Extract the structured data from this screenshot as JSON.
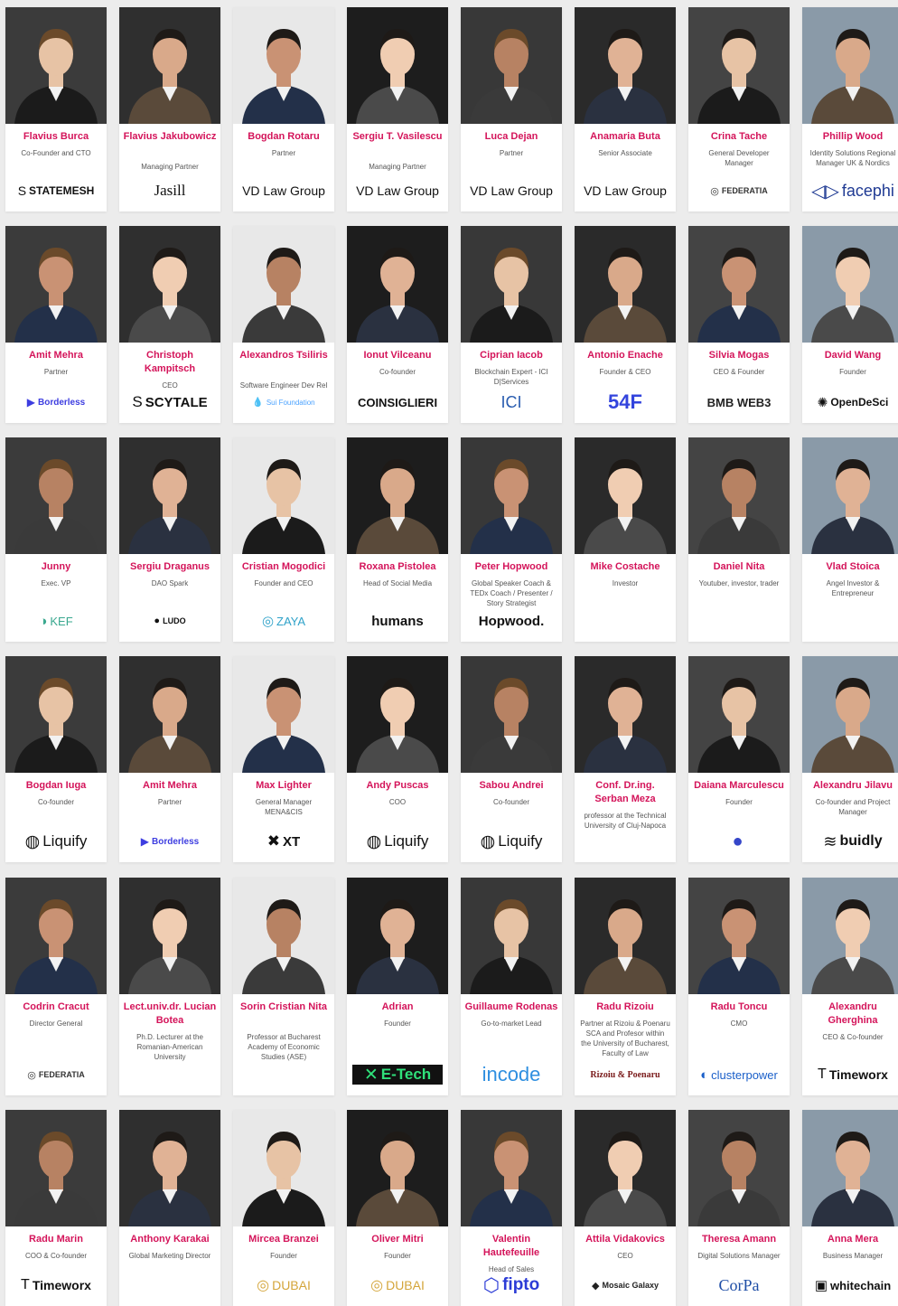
{
  "speakers": [
    {
      "name": "Flavius Burca",
      "role": "Co-Founder and CTO",
      "logo": {
        "text": "STATEMESH",
        "icon": "statemesh-logo-icon",
        "glyph": "S",
        "color": "#111111",
        "size": 12,
        "weight": "bold"
      }
    },
    {
      "name": "Flavius Jakubowicz",
      "role": "Managing Partner",
      "logo": {
        "text": "Jasill",
        "icon": "jasill-logo-icon",
        "glyph": "",
        "color": "#111111",
        "size": 17,
        "weight": "normal",
        "serif": true
      }
    },
    {
      "name": "Bogdan Rotaru",
      "role": "Partner",
      "logo": {
        "text": "VD Law Group",
        "icon": "vd-law-logo-icon",
        "glyph": "",
        "color": "#111111",
        "size": 14,
        "weight": "normal"
      }
    },
    {
      "name": "Sergiu T. Vasilescu",
      "role": "Managing Partner",
      "logo": {
        "text": "VD Law Group",
        "icon": "vd-law-logo-icon",
        "glyph": "",
        "color": "#111111",
        "size": 14,
        "weight": "normal"
      }
    },
    {
      "name": "Luca Dejan",
      "role": "Partner",
      "logo": {
        "text": "VD Law Group",
        "icon": "vd-law-logo-icon",
        "glyph": "",
        "color": "#111111",
        "size": 14,
        "weight": "normal"
      }
    },
    {
      "name": "Anamaria Buta",
      "role": "Senior Associate",
      "logo": {
        "text": "VD Law Group",
        "icon": "vd-law-logo-icon",
        "glyph": "",
        "color": "#111111",
        "size": 14,
        "weight": "normal"
      }
    },
    {
      "name": "Crina Tache",
      "role": "General Developer Manager",
      "logo": {
        "text": "FEDERATIA",
        "icon": "federatia-logo-icon",
        "glyph": "◎",
        "color": "#333333",
        "size": 9,
        "weight": "bold"
      }
    },
    {
      "name": "Phillip Wood",
      "role": "Identity Solutions Regional Manager UK & Nordics",
      "logo": {
        "text": "facephi",
        "icon": "facephi-logo-icon",
        "glyph": "◁▷",
        "color": "#1f3a93",
        "size": 18,
        "weight": "normal"
      }
    },
    {
      "name": "Amit Mehra",
      "role": "Partner",
      "logo": {
        "text": "Borderless",
        "icon": "borderless-logo-icon",
        "glyph": "▶",
        "color": "#3d3de0",
        "size": 10,
        "weight": "bold"
      }
    },
    {
      "name": "Christoph Kampitsch",
      "role": "CEO",
      "logo": {
        "text": "SCYTALE",
        "icon": "scytale-logo-icon",
        "glyph": "S",
        "color": "#111111",
        "size": 15,
        "weight": "bold"
      }
    },
    {
      "name": "Alexandros Tsiliris",
      "role": "Software Engineer Dev Rel",
      "logo": {
        "text": "Sui Foundation",
        "icon": "sui-logo-icon",
        "glyph": "💧",
        "color": "#4ca3ff",
        "size": 8,
        "weight": "normal"
      }
    },
    {
      "name": "Ionut Vilceanu",
      "role": "Co-founder",
      "logo": {
        "text": "COINSIGLIERI",
        "icon": "coinsiglieri-logo-icon",
        "glyph": "",
        "color": "#111111",
        "size": 13,
        "weight": "bold"
      }
    },
    {
      "name": "Ciprian Iacob",
      "role": "Blockchain Expert - ICI D|Services",
      "logo": {
        "text": "ICI",
        "icon": "ici-logo-icon",
        "glyph": "",
        "color": "#2a5db0",
        "size": 18,
        "weight": "normal"
      }
    },
    {
      "name": "Antonio Enache",
      "role": "Founder & CEO",
      "logo": {
        "text": "54F",
        "icon": "54f-logo-icon",
        "glyph": "",
        "color": "#3344dd",
        "size": 22,
        "weight": "bold"
      }
    },
    {
      "name": "Silvia Mogas",
      "role": "CEO & Founder",
      "logo": {
        "text": "BMB WEB3",
        "icon": "bmb-logo-icon",
        "glyph": "",
        "color": "#222222",
        "size": 13,
        "weight": "bold"
      }
    },
    {
      "name": "David Wang",
      "role": "Founder",
      "logo": {
        "text": "OpenDeSci",
        "icon": "opendesci-logo-icon",
        "glyph": "✺",
        "color": "#111111",
        "size": 12,
        "weight": "bold"
      }
    },
    {
      "name": "Junny",
      "role": "Exec. VP",
      "logo": {
        "text": "KEF",
        "icon": "kef-logo-icon",
        "glyph": "◑",
        "color": "#3aa88f",
        "size": 13,
        "weight": "normal"
      }
    },
    {
      "name": "Sergiu Draganus",
      "role": "DAO Spark",
      "logo": {
        "text": "LUDO",
        "icon": "ludo-logo-icon",
        "glyph": "●",
        "color": "#111111",
        "size": 9,
        "weight": "bold"
      }
    },
    {
      "name": "Cristian Mogodici",
      "role": "Founder and CEO",
      "logo": {
        "text": "ZAYA",
        "icon": "zaya-logo-icon",
        "glyph": "◎",
        "color": "#2fa2c9",
        "size": 13,
        "weight": "normal"
      }
    },
    {
      "name": "Roxana Pistolea",
      "role": "Head of Social Media",
      "logo": {
        "text": "humans",
        "icon": "humans-logo-icon",
        "glyph": "",
        "color": "#111111",
        "size": 15,
        "weight": "bold"
      }
    },
    {
      "name": "Peter Hopwood",
      "role": "Global Speaker Coach & TEDx Coach / Presenter / Story Strategist",
      "logo": {
        "text": "Hopwood.",
        "icon": "hopwood-logo-icon",
        "glyph": "",
        "color": "#111111",
        "size": 15,
        "weight": "bold"
      }
    },
    {
      "name": "Mike Costache",
      "role": "Investor",
      "logo": {
        "text": "",
        "icon": "",
        "glyph": "",
        "color": "#111111",
        "size": 12,
        "weight": "normal"
      }
    },
    {
      "name": "Daniel Nita",
      "role": "Youtuber, investor, trader",
      "logo": {
        "text": "",
        "icon": "",
        "glyph": "",
        "color": "#111111",
        "size": 12,
        "weight": "normal"
      }
    },
    {
      "name": "Vlad Stoica",
      "role": "Angel Investor & Entrepreneur",
      "logo": {
        "text": "",
        "icon": "",
        "glyph": "",
        "color": "#111111",
        "size": 12,
        "weight": "normal"
      }
    },
    {
      "name": "Bogdan Iuga",
      "role": "Co-founder",
      "logo": {
        "text": "Liquify",
        "icon": "liquify-logo-icon",
        "glyph": "◍",
        "color": "#111111",
        "size": 17,
        "weight": "normal"
      }
    },
    {
      "name": "Amit Mehra",
      "role": "Partner",
      "logo": {
        "text": "Borderless",
        "icon": "borderless-logo-icon",
        "glyph": "▶",
        "color": "#3d3de0",
        "size": 10,
        "weight": "bold"
      }
    },
    {
      "name": "Max Lighter",
      "role": "General Manager MENA&CIS",
      "logo": {
        "text": "XT",
        "icon": "xt-logo-icon",
        "glyph": "✖",
        "color": "#111111",
        "size": 15,
        "weight": "bold"
      }
    },
    {
      "name": "Andy Puscas",
      "role": "COO",
      "logo": {
        "text": "Liquify",
        "icon": "liquify-logo-icon",
        "glyph": "◍",
        "color": "#111111",
        "size": 17,
        "weight": "normal"
      }
    },
    {
      "name": "Sabou Andrei",
      "role": "Co-founder",
      "logo": {
        "text": "Liquify",
        "icon": "liquify-logo-icon",
        "glyph": "◍",
        "color": "#111111",
        "size": 17,
        "weight": "normal"
      }
    },
    {
      "name": "Conf. Dr.ing. Serban Meza",
      "role": "professor at the Technical University of Cluj-Napoca",
      "logo": {
        "text": "",
        "icon": "",
        "glyph": "",
        "color": "#111111",
        "size": 12,
        "weight": "normal"
      }
    },
    {
      "name": "Daiana Marculescu",
      "role": "Founder",
      "logo": {
        "text": "",
        "icon": "round-logo-icon",
        "glyph": "●",
        "color": "#3546c9",
        "size": 18,
        "weight": "normal"
      }
    },
    {
      "name": "Alexandru Jilavu",
      "role": "Co-founder and Project Manager",
      "logo": {
        "text": "buidly",
        "icon": "buidly-logo-icon",
        "glyph": "≋",
        "color": "#111111",
        "size": 16,
        "weight": "bold"
      }
    },
    {
      "name": "Codrin Cracut",
      "role": "Director General",
      "logo": {
        "text": "FEDERATIA",
        "icon": "federatia-logo-icon",
        "glyph": "◎",
        "color": "#333333",
        "size": 9,
        "weight": "bold"
      }
    },
    {
      "name": "Lect.univ.dr. Lucian Botea",
      "role": "Ph.D. Lecturer at the Romanian-American University",
      "logo": {
        "text": "",
        "icon": "",
        "glyph": "",
        "color": "#111111",
        "size": 12,
        "weight": "normal"
      }
    },
    {
      "name": "Sorin Cristian Nita",
      "role": "Professor at Bucharest Academy of Economic Studies (ASE)",
      "logo": {
        "text": "",
        "icon": "",
        "glyph": "",
        "color": "#111111",
        "size": 12,
        "weight": "normal"
      }
    },
    {
      "name": "Adrian",
      "role": "Founder",
      "logo": {
        "text": "E-Tech",
        "icon": "etech-logo-icon",
        "glyph": "✕",
        "color": "#2fe07a",
        "size": 17,
        "weight": "bold",
        "dark": true
      }
    },
    {
      "name": "Guillaume Rodenas",
      "role": "Go-to-market Lead",
      "logo": {
        "text": "incode",
        "icon": "incode-logo-icon",
        "glyph": "",
        "color": "#2f8fe0",
        "size": 22,
        "weight": "normal"
      }
    },
    {
      "name": "Radu Rizoiu",
      "role": "Partner at Rizoiu & Poenaru SCA and Profesor within the University of Bucharest, Faculty of Law",
      "logo": {
        "text": "Rizoiu & Poenaru",
        "icon": "rizoiu-logo-icon",
        "glyph": "",
        "color": "#7a1b1b",
        "size": 10,
        "weight": "bold",
        "serif": true
      }
    },
    {
      "name": "Radu Toncu",
      "role": "CMO",
      "logo": {
        "text": "clusterpower",
        "icon": "clusterpower-logo-icon",
        "glyph": "◐",
        "color": "#1a5fc9",
        "size": 13,
        "weight": "normal"
      }
    },
    {
      "name": "Alexandru Gherghina",
      "role": "CEO & Co-founder",
      "logo": {
        "text": "Timeworx",
        "icon": "timeworx-logo-icon",
        "glyph": "T",
        "color": "#111111",
        "size": 14,
        "weight": "bold"
      }
    },
    {
      "name": "Radu Marin",
      "role": "COO & Co-founder",
      "logo": {
        "text": "Timeworx",
        "icon": "timeworx-logo-icon",
        "glyph": "T",
        "color": "#111111",
        "size": 14,
        "weight": "bold"
      }
    },
    {
      "name": "Anthony Karakai",
      "role": "Global Marketing Director",
      "logo": {
        "text": "",
        "icon": "",
        "glyph": "",
        "color": "#111111",
        "size": 12,
        "weight": "normal"
      }
    },
    {
      "name": "Mircea Branzei",
      "role": "Founder",
      "logo": {
        "text": "DUBAI",
        "icon": "imobiliare-logo-icon",
        "glyph": "◎",
        "color": "#d4a53a",
        "size": 14,
        "weight": "normal"
      }
    },
    {
      "name": "Oliver Mitri",
      "role": "Founder",
      "logo": {
        "text": "DUBAI",
        "icon": "imobiliare-logo-icon",
        "glyph": "◎",
        "color": "#d4a53a",
        "size": 14,
        "weight": "normal"
      }
    },
    {
      "name": "Valentin Hautefeuille",
      "role": "Head of Sales",
      "logo": {
        "text": "fipto",
        "icon": "fipto-logo-icon",
        "glyph": "⬡",
        "color": "#2b3bd6",
        "size": 19,
        "weight": "bold"
      }
    },
    {
      "name": "Attila Vidakovics",
      "role": "CEO",
      "logo": {
        "text": "Mosaic Galaxy",
        "icon": "mosaic-logo-icon",
        "glyph": "◆",
        "color": "#222222",
        "size": 9,
        "weight": "bold"
      }
    },
    {
      "name": "Theresa Amann",
      "role": "Digital Solutions Manager",
      "logo": {
        "text": "CorPa",
        "icon": "corpa-logo-icon",
        "glyph": "",
        "color": "#1f4ea6",
        "size": 18,
        "weight": "normal",
        "serif": true
      }
    },
    {
      "name": "Anna Mera",
      "role": "Business Manager",
      "logo": {
        "text": "whitechain",
        "icon": "whitechain-logo-icon",
        "glyph": "▣",
        "color": "#111111",
        "size": 13,
        "weight": "bold"
      }
    }
  ],
  "palette": {
    "accent": "#d4145a",
    "role_text": "#555555",
    "card_bg": "#ffffff",
    "page_bg": "#ececec"
  }
}
